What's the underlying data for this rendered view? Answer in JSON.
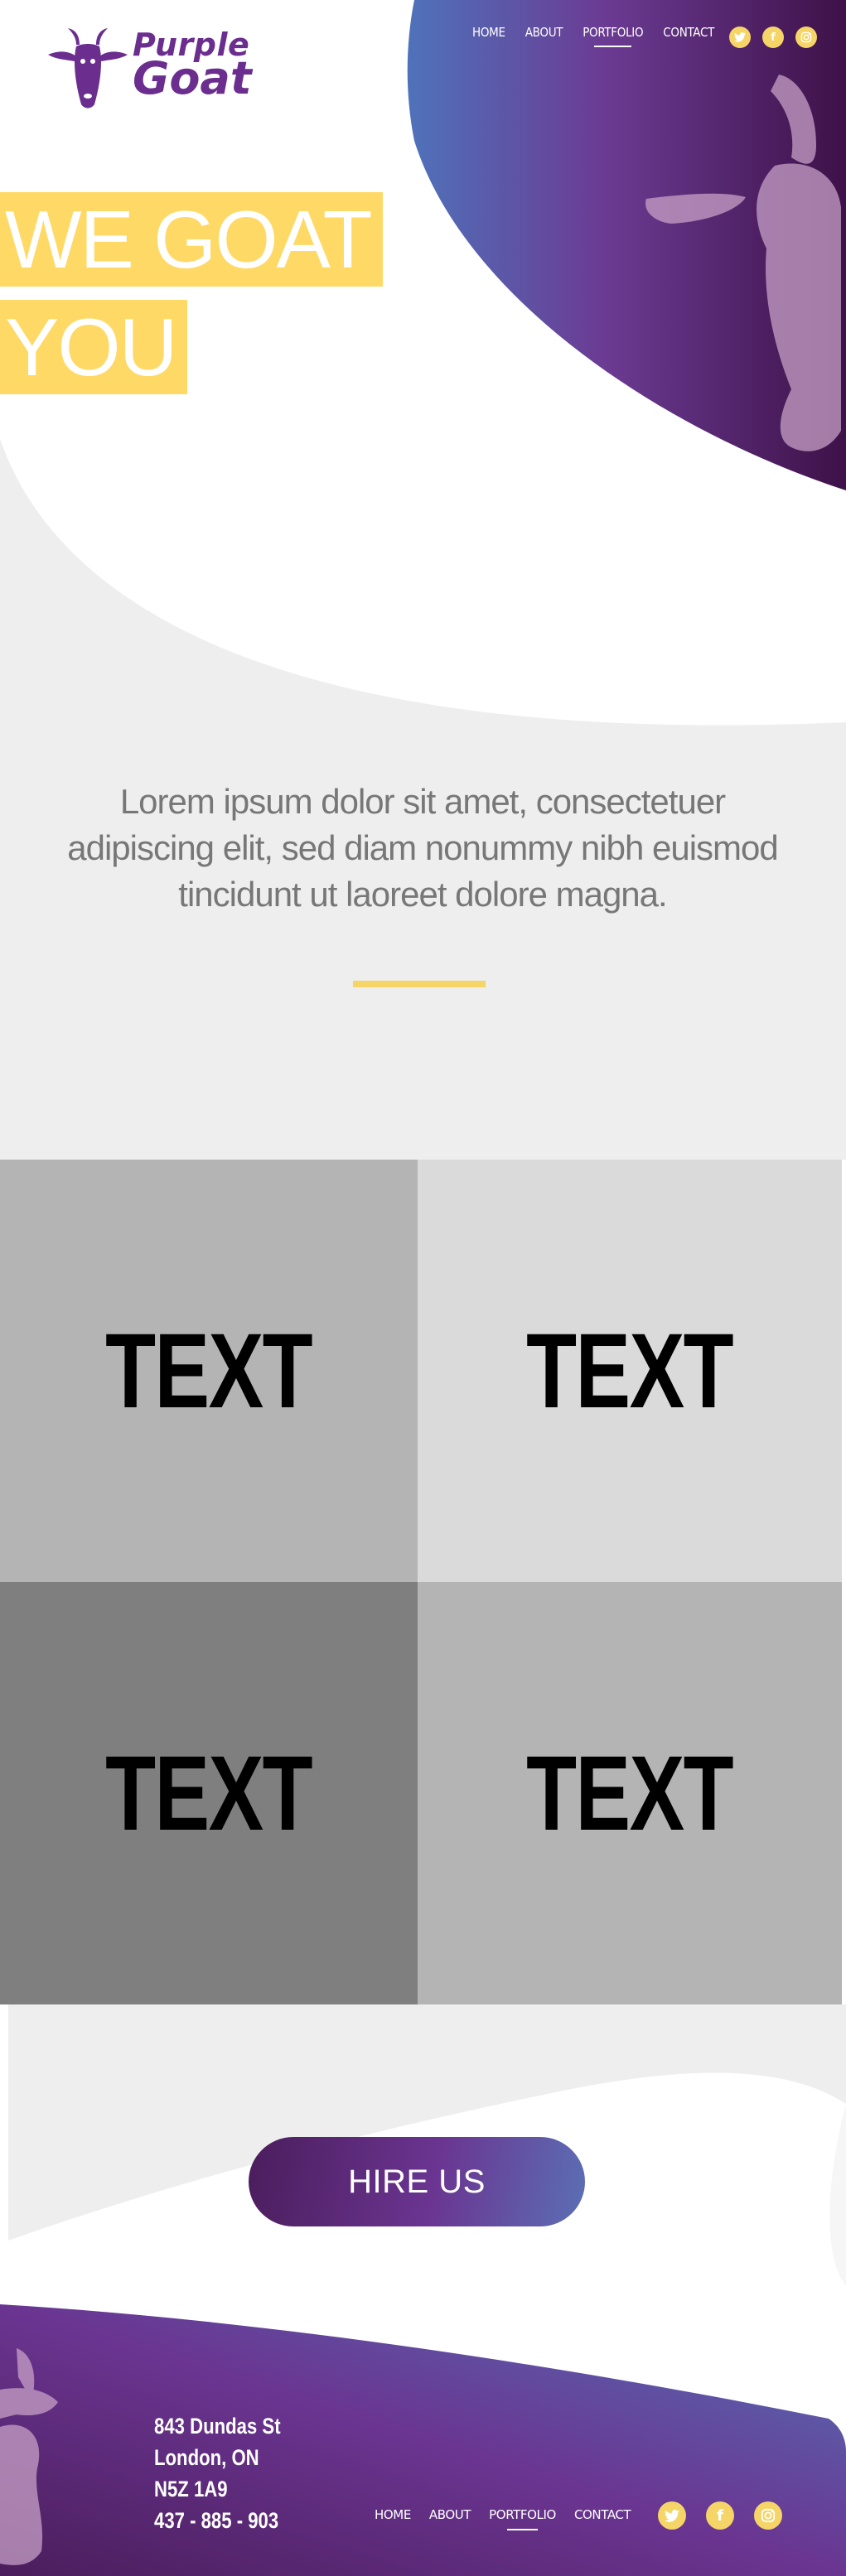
{
  "brand": {
    "name_line1": "Purple",
    "name_line2": "Goat"
  },
  "colors": {
    "purple": "#6b2e8f",
    "blue": "#4f6fb8",
    "yellow": "#ffd966",
    "light_gray_bg": "#eeeeee"
  },
  "nav": {
    "items": [
      {
        "label": "HOME"
      },
      {
        "label": "ABOUT"
      },
      {
        "label": "PORTFOLIO",
        "active": true
      },
      {
        "label": "CONTACT"
      }
    ]
  },
  "social": [
    {
      "icon": "twitter-icon",
      "glyph": "🐦"
    },
    {
      "icon": "facebook-icon",
      "glyph": "f"
    },
    {
      "icon": "instagram-icon",
      "glyph": "◎"
    }
  ],
  "hero": {
    "line1": "WE GOAT",
    "line2": "YOU"
  },
  "intro": {
    "text": "Lorem ipsum dolor sit amet, consectetuer adipiscing elit, sed diam nonummy nibh euismod tincidunt ut laoreet dolore magna."
  },
  "grid": {
    "tiles": [
      {
        "label": "TEXT"
      },
      {
        "label": "TEXT"
      },
      {
        "label": "TEXT"
      },
      {
        "label": "TEXT"
      }
    ]
  },
  "cta": {
    "label": "HIRE US"
  },
  "footer": {
    "address": [
      "843 Dundas St",
      "London, ON",
      "N5Z 1A9",
      "437 - 885 - 903"
    ],
    "nav": [
      {
        "label": "HOME"
      },
      {
        "label": "ABOUT"
      },
      {
        "label": "PORTFOLIO",
        "active": true
      },
      {
        "label": "CONTACT"
      }
    ]
  }
}
